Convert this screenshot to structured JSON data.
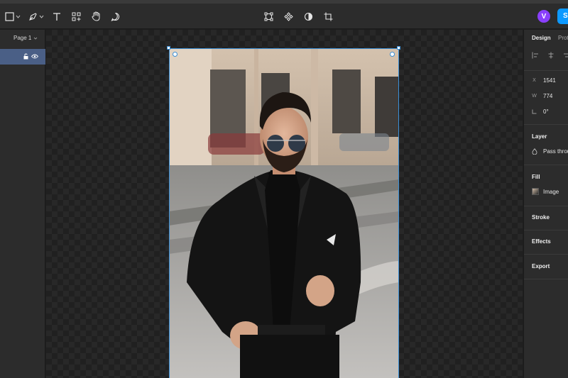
{
  "toolbar": {
    "left_tools": [
      "frame-tool",
      "pen-tool",
      "text-tool",
      "resources-tool",
      "hand-tool",
      "comment-tool"
    ],
    "center_tools": [
      "edit-object-tool",
      "component-tool",
      "mask-tool",
      "crop-tool"
    ],
    "avatar_initial": "V",
    "share_label": "Share"
  },
  "left_panel": {
    "page_label": "Page 1"
  },
  "canvas": {
    "selected_layer": "image-frame"
  },
  "right_panel": {
    "tabs": [
      "Design",
      "Prototype"
    ],
    "position": {
      "x_label": "X",
      "x_value": "1541",
      "w_label": "W",
      "w_value": "774",
      "rotation_value": "0°"
    },
    "layer": {
      "title": "Layer",
      "blend_mode": "Pass through"
    },
    "fill": {
      "title": "Fill",
      "type": "Image"
    },
    "sections": [
      "Stroke",
      "Effects",
      "Export"
    ]
  },
  "colors": {
    "accent": "#0d99ff",
    "selection": "#3b8fd6",
    "avatar": "#8a3ffc",
    "layer_highlight": "#4a5f86"
  }
}
